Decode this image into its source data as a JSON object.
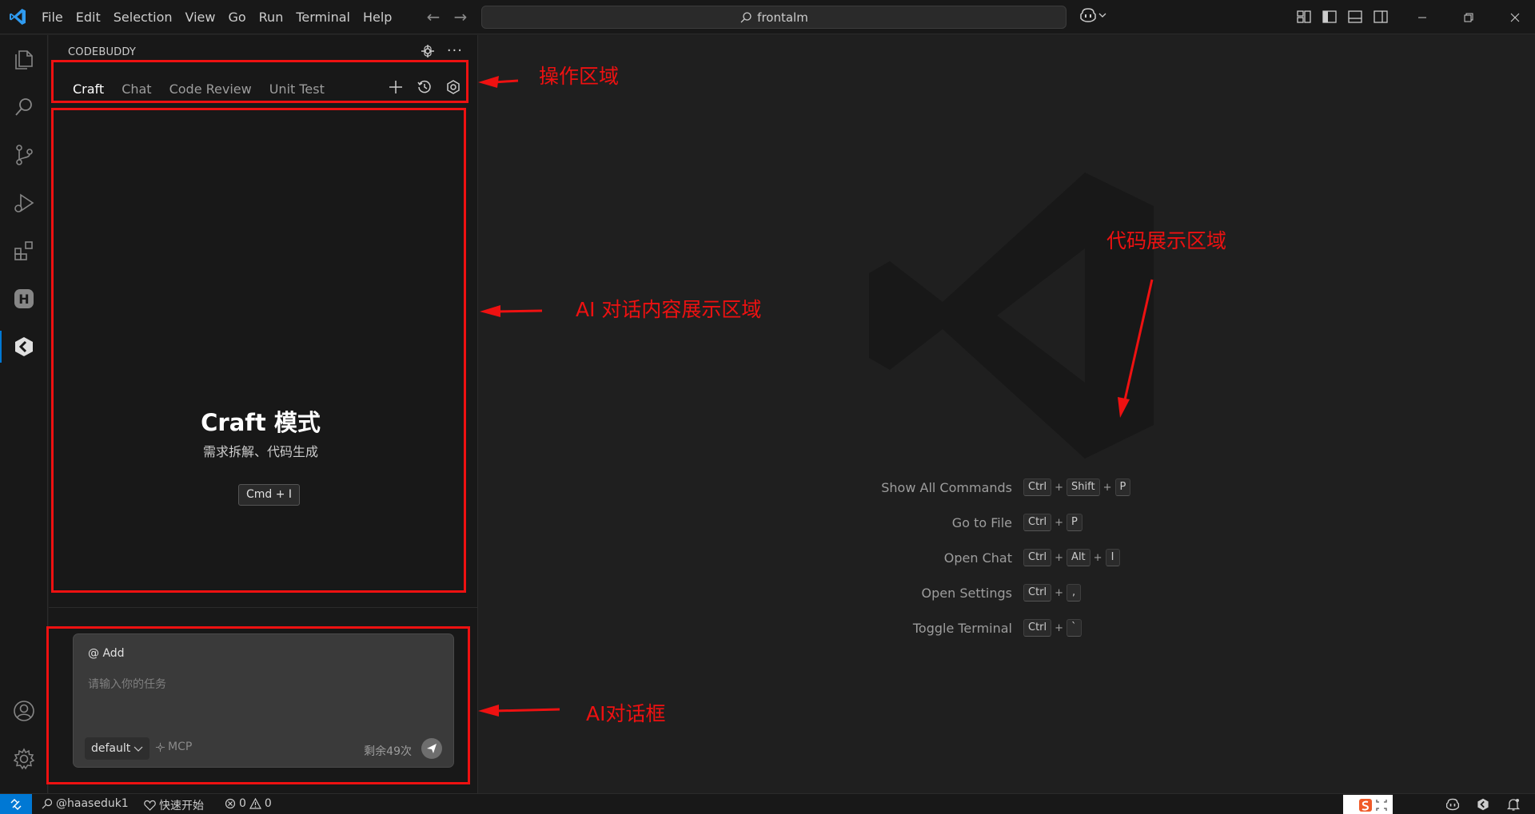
{
  "titlebar": {
    "menu": [
      "File",
      "Edit",
      "Selection",
      "View",
      "Go",
      "Run",
      "Terminal",
      "Help"
    ],
    "search_text": "frontalm"
  },
  "sidebar": {
    "title": "CODEBUDDY",
    "tabs": [
      "Craft",
      "Chat",
      "Code Review",
      "Unit Test"
    ],
    "active_tab": "Craft",
    "craft_title": "Craft 模式",
    "craft_subtitle": "需求拆解、代码生成",
    "craft_shortcut": "Cmd + I",
    "chat": {
      "add_label": "@ Add",
      "placeholder": "请输入你的任务",
      "model": "default",
      "mcp_label": "MCP",
      "remaining": "剩余49次"
    }
  },
  "editor": {
    "shortcuts": [
      {
        "label": "Show All Commands",
        "keys": [
          "Ctrl",
          "Shift",
          "P"
        ]
      },
      {
        "label": "Go to File",
        "keys": [
          "Ctrl",
          "P"
        ]
      },
      {
        "label": "Open Chat",
        "keys": [
          "Ctrl",
          "Alt",
          "I"
        ]
      },
      {
        "label": "Open Settings",
        "keys": [
          "Ctrl",
          ","
        ]
      },
      {
        "label": "Toggle Terminal",
        "keys": [
          "Ctrl",
          "`"
        ]
      }
    ]
  },
  "statusbar": {
    "user": "@haaseduk1",
    "quick_start": "快速开始",
    "errors": "0",
    "warnings": "0"
  },
  "annotations": {
    "operation_area": "操作区域",
    "chat_content_area": "AI 对话内容展示区域",
    "code_display_area": "代码展示区域",
    "chat_box": "AI对话框"
  },
  "colors": {
    "accent": "#0078d4",
    "annotation": "#ee1111",
    "background": "#1f1f1f",
    "panel": "#181818"
  }
}
